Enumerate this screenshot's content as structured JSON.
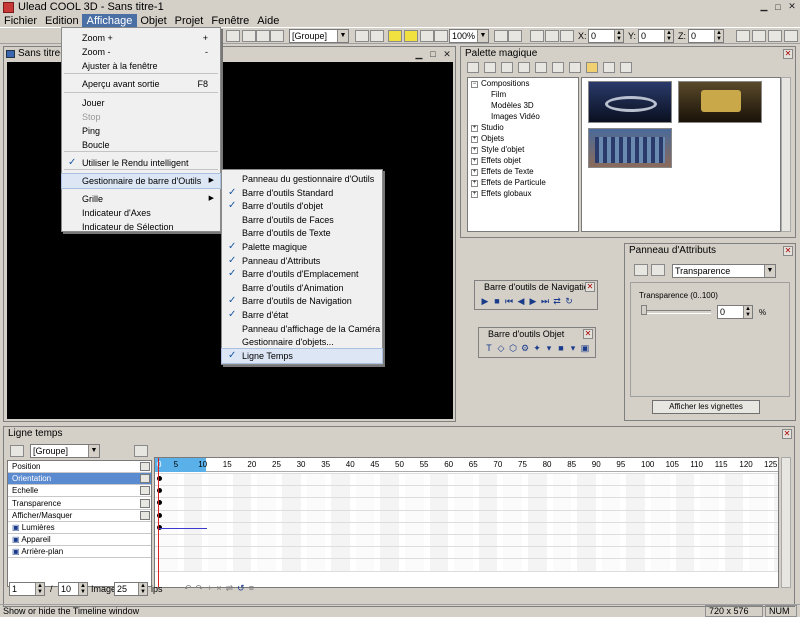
{
  "window": {
    "title": "Ulead COOL 3D - Sans titre-1"
  },
  "menubar": [
    "Fichier",
    "Edition",
    "Affichage",
    "Objet",
    "Projet",
    "Fenêtre",
    "Aide"
  ],
  "toolbar": {
    "group_combo": "[Groupe]",
    "zoom_combo": "100%",
    "x_label": "X:",
    "x_value": "0",
    "y_label": "Y:",
    "y_value": "0",
    "z_label": "Z:",
    "z_value": "0"
  },
  "document": {
    "title": "Sans titre-1"
  },
  "affichage_menu": {
    "items": [
      {
        "label": "Zoom +",
        "shortcut": "+"
      },
      {
        "label": "Zoom -",
        "shortcut": "-"
      },
      {
        "label": "Ajuster à la fenêtre"
      },
      {
        "label": "Aperçu avant sortie",
        "shortcut": "F8"
      },
      {
        "label": "Jouer"
      },
      {
        "label": "Stop",
        "disabled": true
      },
      {
        "label": "Ping"
      },
      {
        "label": "Boucle"
      },
      {
        "label": "Utiliser le Rendu intelligent",
        "checked": true
      },
      {
        "label": "Gestionnaire de barre d'Outils",
        "submenu": true,
        "highlighted": true
      },
      {
        "label": "Grille",
        "submenu": true
      },
      {
        "label": "Indicateur d'Axes"
      },
      {
        "label": "Indicateur de Sélection"
      }
    ]
  },
  "toolbar_submenu": {
    "items": [
      {
        "label": "Panneau du gestionnaire d'Outils",
        "checked": false
      },
      {
        "label": "Barre d'outils Standard",
        "checked": true
      },
      {
        "label": "Barre d'outils d'objet",
        "checked": true
      },
      {
        "label": "Barre d'outils de Faces",
        "checked": false
      },
      {
        "label": "Barre d'outils de Texte",
        "checked": false
      },
      {
        "label": "Palette magique",
        "checked": true
      },
      {
        "label": "Panneau d'Attributs",
        "checked": true
      },
      {
        "label": "Barre d'outils d'Emplacement",
        "checked": true
      },
      {
        "label": "Barre d'outils d'Animation",
        "checked": false
      },
      {
        "label": "Barre d'outils de Navigation",
        "checked": true
      },
      {
        "label": "Barre d'état",
        "checked": true
      },
      {
        "label": "Panneau d'affichage de la Caméra",
        "checked": false
      },
      {
        "label": "Gestionnaire d'objets...",
        "checked": false
      },
      {
        "label": "Ligne Temps",
        "checked": true,
        "highlighted": true
      }
    ]
  },
  "palette": {
    "title": "Palette magique",
    "tree": [
      {
        "label": "Compositions",
        "level": 0,
        "expanded": true
      },
      {
        "label": "Film",
        "level": 1
      },
      {
        "label": "Modèles 3D",
        "level": 1
      },
      {
        "label": "Images Vidéo",
        "level": 1
      },
      {
        "label": "Studio",
        "level": 0
      },
      {
        "label": "Objets",
        "level": 0
      },
      {
        "label": "Style d'objet",
        "level": 0
      },
      {
        "label": "Effets objet",
        "level": 0
      },
      {
        "label": "Effets de Texte",
        "level": 0
      },
      {
        "label": "Effets de Particule",
        "level": 0
      },
      {
        "label": "Effets globaux",
        "level": 0
      }
    ]
  },
  "navigation_toolbar": {
    "title": "Barre d'outils de Navigation"
  },
  "object_toolbar": {
    "title": "Barre d'outils Objet"
  },
  "attributes": {
    "title": "Panneau d'Attributs",
    "combo": "Transparence",
    "slider_label": "Transparence (0..100)",
    "value": "0",
    "unit": "%",
    "level": 0,
    "thumbnails_button": "Afficher les vignettes"
  },
  "timeline": {
    "title": "Ligne temps",
    "group_combo": "[Groupe]",
    "tracks": [
      "Position",
      "Orientation",
      "Echelle",
      "Transparence",
      "Afficher/Masquer",
      "Lumières",
      "Appareil",
      "Arrière-plan"
    ],
    "selected_track": "Orientation",
    "ruler": [
      "0",
      "5",
      "10",
      "15",
      "20",
      "25",
      "30",
      "35",
      "40",
      "45",
      "50",
      "55",
      "60",
      "65",
      "70",
      "75",
      "80",
      "85",
      "90",
      "95",
      "100",
      "105",
      "110",
      "115",
      "120",
      "125"
    ],
    "current_frame": "1",
    "separator": "/",
    "total_frames": "10",
    "images_label": "Images",
    "fps_value": "25",
    "fps_label": "ips"
  },
  "statusbar": {
    "message": "Show or hide the Timeline window",
    "size": "720 x 576",
    "num": "NUM"
  }
}
